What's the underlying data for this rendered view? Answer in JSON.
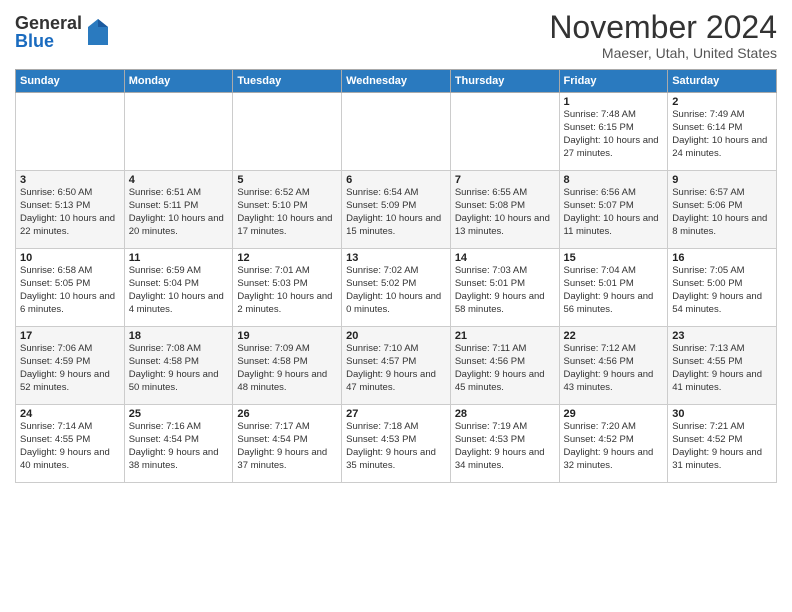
{
  "header": {
    "logo_general": "General",
    "logo_blue": "Blue",
    "month_title": "November 2024",
    "location": "Maeser, Utah, United States"
  },
  "weekdays": [
    "Sunday",
    "Monday",
    "Tuesday",
    "Wednesday",
    "Thursday",
    "Friday",
    "Saturday"
  ],
  "weeks": [
    [
      {
        "day": "",
        "info": ""
      },
      {
        "day": "",
        "info": ""
      },
      {
        "day": "",
        "info": ""
      },
      {
        "day": "",
        "info": ""
      },
      {
        "day": "",
        "info": ""
      },
      {
        "day": "1",
        "info": "Sunrise: 7:48 AM\nSunset: 6:15 PM\nDaylight: 10 hours and 27 minutes."
      },
      {
        "day": "2",
        "info": "Sunrise: 7:49 AM\nSunset: 6:14 PM\nDaylight: 10 hours and 24 minutes."
      }
    ],
    [
      {
        "day": "3",
        "info": "Sunrise: 6:50 AM\nSunset: 5:13 PM\nDaylight: 10 hours and 22 minutes."
      },
      {
        "day": "4",
        "info": "Sunrise: 6:51 AM\nSunset: 5:11 PM\nDaylight: 10 hours and 20 minutes."
      },
      {
        "day": "5",
        "info": "Sunrise: 6:52 AM\nSunset: 5:10 PM\nDaylight: 10 hours and 17 minutes."
      },
      {
        "day": "6",
        "info": "Sunrise: 6:54 AM\nSunset: 5:09 PM\nDaylight: 10 hours and 15 minutes."
      },
      {
        "day": "7",
        "info": "Sunrise: 6:55 AM\nSunset: 5:08 PM\nDaylight: 10 hours and 13 minutes."
      },
      {
        "day": "8",
        "info": "Sunrise: 6:56 AM\nSunset: 5:07 PM\nDaylight: 10 hours and 11 minutes."
      },
      {
        "day": "9",
        "info": "Sunrise: 6:57 AM\nSunset: 5:06 PM\nDaylight: 10 hours and 8 minutes."
      }
    ],
    [
      {
        "day": "10",
        "info": "Sunrise: 6:58 AM\nSunset: 5:05 PM\nDaylight: 10 hours and 6 minutes."
      },
      {
        "day": "11",
        "info": "Sunrise: 6:59 AM\nSunset: 5:04 PM\nDaylight: 10 hours and 4 minutes."
      },
      {
        "day": "12",
        "info": "Sunrise: 7:01 AM\nSunset: 5:03 PM\nDaylight: 10 hours and 2 minutes."
      },
      {
        "day": "13",
        "info": "Sunrise: 7:02 AM\nSunset: 5:02 PM\nDaylight: 10 hours and 0 minutes."
      },
      {
        "day": "14",
        "info": "Sunrise: 7:03 AM\nSunset: 5:01 PM\nDaylight: 9 hours and 58 minutes."
      },
      {
        "day": "15",
        "info": "Sunrise: 7:04 AM\nSunset: 5:01 PM\nDaylight: 9 hours and 56 minutes."
      },
      {
        "day": "16",
        "info": "Sunrise: 7:05 AM\nSunset: 5:00 PM\nDaylight: 9 hours and 54 minutes."
      }
    ],
    [
      {
        "day": "17",
        "info": "Sunrise: 7:06 AM\nSunset: 4:59 PM\nDaylight: 9 hours and 52 minutes."
      },
      {
        "day": "18",
        "info": "Sunrise: 7:08 AM\nSunset: 4:58 PM\nDaylight: 9 hours and 50 minutes."
      },
      {
        "day": "19",
        "info": "Sunrise: 7:09 AM\nSunset: 4:58 PM\nDaylight: 9 hours and 48 minutes."
      },
      {
        "day": "20",
        "info": "Sunrise: 7:10 AM\nSunset: 4:57 PM\nDaylight: 9 hours and 47 minutes."
      },
      {
        "day": "21",
        "info": "Sunrise: 7:11 AM\nSunset: 4:56 PM\nDaylight: 9 hours and 45 minutes."
      },
      {
        "day": "22",
        "info": "Sunrise: 7:12 AM\nSunset: 4:56 PM\nDaylight: 9 hours and 43 minutes."
      },
      {
        "day": "23",
        "info": "Sunrise: 7:13 AM\nSunset: 4:55 PM\nDaylight: 9 hours and 41 minutes."
      }
    ],
    [
      {
        "day": "24",
        "info": "Sunrise: 7:14 AM\nSunset: 4:55 PM\nDaylight: 9 hours and 40 minutes."
      },
      {
        "day": "25",
        "info": "Sunrise: 7:16 AM\nSunset: 4:54 PM\nDaylight: 9 hours and 38 minutes."
      },
      {
        "day": "26",
        "info": "Sunrise: 7:17 AM\nSunset: 4:54 PM\nDaylight: 9 hours and 37 minutes."
      },
      {
        "day": "27",
        "info": "Sunrise: 7:18 AM\nSunset: 4:53 PM\nDaylight: 9 hours and 35 minutes."
      },
      {
        "day": "28",
        "info": "Sunrise: 7:19 AM\nSunset: 4:53 PM\nDaylight: 9 hours and 34 minutes."
      },
      {
        "day": "29",
        "info": "Sunrise: 7:20 AM\nSunset: 4:52 PM\nDaylight: 9 hours and 32 minutes."
      },
      {
        "day": "30",
        "info": "Sunrise: 7:21 AM\nSunset: 4:52 PM\nDaylight: 9 hours and 31 minutes."
      }
    ]
  ]
}
